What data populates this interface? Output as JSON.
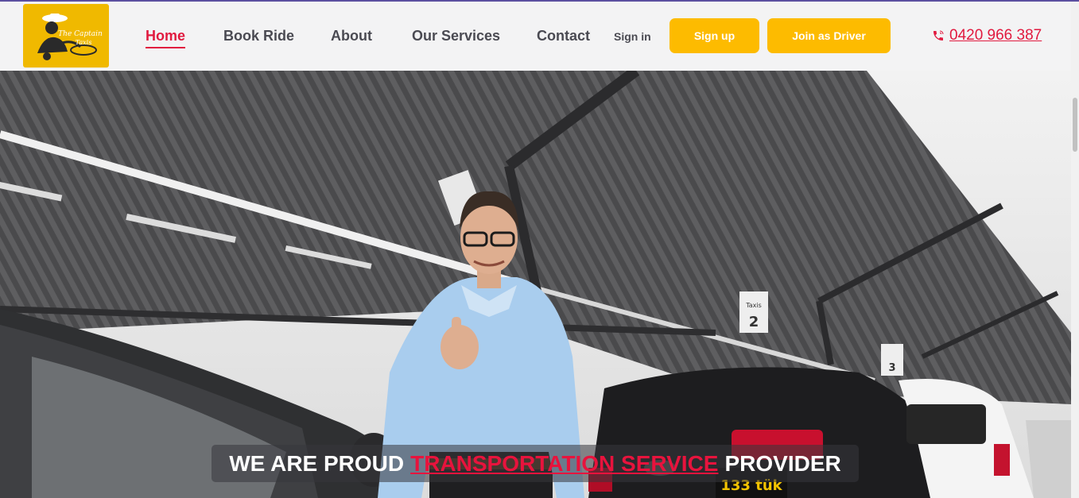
{
  "brand": {
    "logo_line1": "The Captain",
    "logo_line2": "Taxis"
  },
  "nav": {
    "items": [
      {
        "label": "Home",
        "active": true
      },
      {
        "label": "Book Ride",
        "active": false
      },
      {
        "label": "About",
        "active": false
      },
      {
        "label": "Our Services",
        "active": false
      },
      {
        "label": "Contact",
        "active": false
      }
    ],
    "signin_label": "Sign in",
    "signup_label": "Sign up",
    "join_driver_label": "Join as Driver",
    "phone_icon": "phone-icon",
    "phone_number": "0420 966 387"
  },
  "hero": {
    "tagline_before": "WE ARE PROUD",
    "tagline_highlight": "TRANSPORTATION SERVICE",
    "tagline_after": "PROVIDER",
    "sign_text": "Taxis",
    "sign_numbers": [
      "2",
      "3"
    ],
    "rear_badge": "133 tük"
  },
  "colors": {
    "accent": "#e11a3f",
    "button_yellow": "#fdbb00",
    "logo_bg": "#f0b900"
  }
}
